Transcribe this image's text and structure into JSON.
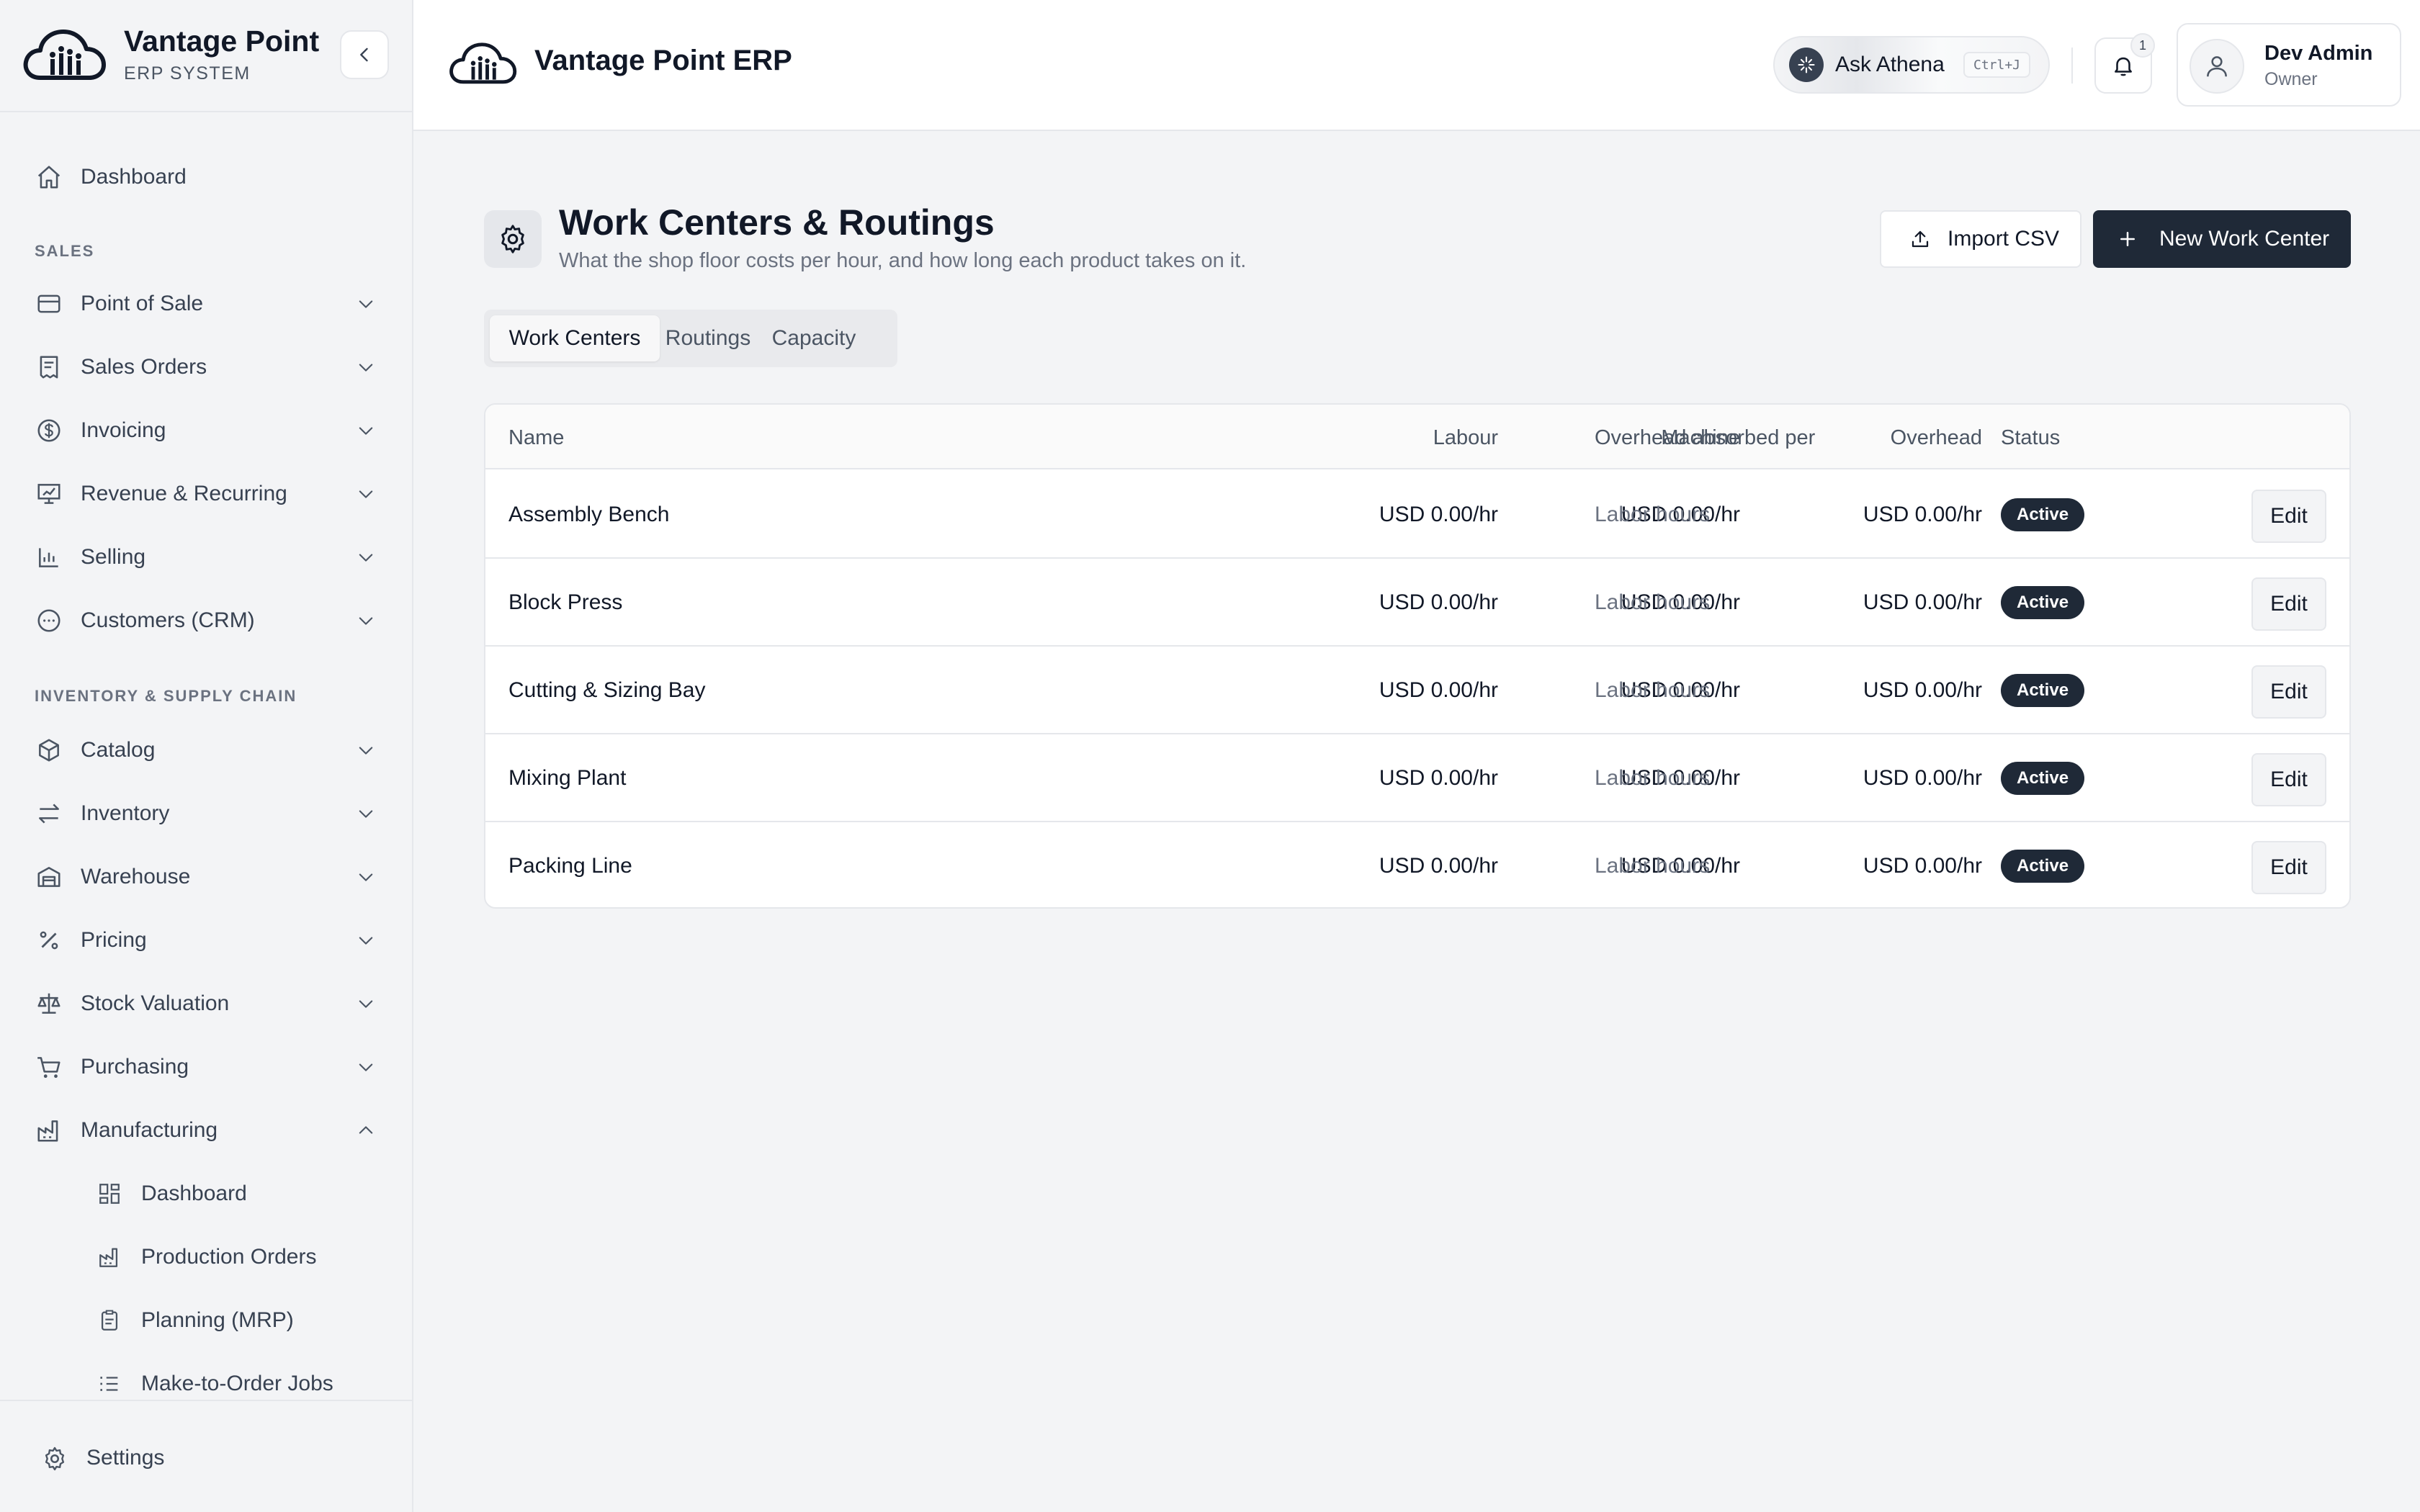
{
  "brand": {
    "title": "Vantage Point",
    "subtitle": "ERP SYSTEM"
  },
  "sidebar": {
    "top_item": {
      "label": "Dashboard",
      "icon": "home-icon"
    },
    "sections": [
      {
        "label": "SALES",
        "items": [
          {
            "label": "Point of Sale",
            "icon": "credit-card-icon",
            "expanded": false
          },
          {
            "label": "Sales Orders",
            "icon": "receipt-icon",
            "expanded": false
          },
          {
            "label": "Invoicing",
            "icon": "dollar-circle-icon",
            "expanded": false
          },
          {
            "label": "Revenue & Recurring",
            "icon": "presentation-chart-icon",
            "expanded": false
          },
          {
            "label": "Selling",
            "icon": "bar-chart-icon",
            "expanded": false
          },
          {
            "label": "Customers (CRM)",
            "icon": "chat-bubble-icon",
            "expanded": false
          }
        ]
      },
      {
        "label": "INVENTORY & SUPPLY CHAIN",
        "items": [
          {
            "label": "Catalog",
            "icon": "package-icon",
            "expanded": false
          },
          {
            "label": "Inventory",
            "icon": "arrows-left-right-icon",
            "expanded": false
          },
          {
            "label": "Warehouse",
            "icon": "warehouse-icon",
            "expanded": false
          },
          {
            "label": "Pricing",
            "icon": "percent-icon",
            "expanded": false
          },
          {
            "label": "Stock Valuation",
            "icon": "scale-icon",
            "expanded": false
          },
          {
            "label": "Purchasing",
            "icon": "shopping-cart-icon",
            "expanded": false
          },
          {
            "label": "Manufacturing",
            "icon": "factory-icon",
            "expanded": true
          }
        ]
      }
    ],
    "manufacturing_children": [
      {
        "label": "Dashboard",
        "icon": "grid-icon"
      },
      {
        "label": "Production Orders",
        "icon": "factory-icon"
      },
      {
        "label": "Planning (MRP)",
        "icon": "clipboard-icon"
      },
      {
        "label": "Make-to-Order Jobs",
        "icon": "list-icon"
      }
    ],
    "footer": {
      "label": "Settings",
      "icon": "gear-icon"
    }
  },
  "topbar": {
    "title": "Vantage Point ERP",
    "ask": {
      "label": "Ask Athena",
      "shortcut": "Ctrl+J"
    },
    "notifications_count": "1",
    "user": {
      "name": "Dev Admin",
      "role": "Owner"
    }
  },
  "page": {
    "title": "Work Centers & Routings",
    "subtitle": "What the shop floor costs per hour, and how long each product takes on it.",
    "import_label": "Import CSV",
    "new_label": "New Work Center"
  },
  "tabs": [
    {
      "label": "Work Centers",
      "active": true
    },
    {
      "label": "Routings",
      "active": false
    },
    {
      "label": "Capacity",
      "active": false
    }
  ],
  "table": {
    "columns": {
      "name": "Name",
      "labour": "Labour",
      "machine": "Machine",
      "overhead": "Overhead",
      "absorbed": "Overhead absorbed per",
      "status": "Status"
    },
    "edit_label": "Edit",
    "rows": [
      {
        "name": "Assembly Bench",
        "labour": "USD 0.00/hr",
        "machine": "USD 0.00/hr",
        "overhead": "USD 0.00/hr",
        "absorbed": "Labor hours",
        "status": "Active"
      },
      {
        "name": "Block Press",
        "labour": "USD 0.00/hr",
        "machine": "USD 0.00/hr",
        "overhead": "USD 0.00/hr",
        "absorbed": "Labor hours",
        "status": "Active"
      },
      {
        "name": "Cutting & Sizing Bay",
        "labour": "USD 0.00/hr",
        "machine": "USD 0.00/hr",
        "overhead": "USD 0.00/hr",
        "absorbed": "Labor hours",
        "status": "Active"
      },
      {
        "name": "Mixing Plant",
        "labour": "USD 0.00/hr",
        "machine": "USD 0.00/hr",
        "overhead": "USD 0.00/hr",
        "absorbed": "Labor hours",
        "status": "Active"
      },
      {
        "name": "Packing Line",
        "labour": "USD 0.00/hr",
        "machine": "USD 0.00/hr",
        "overhead": "USD 0.00/hr",
        "absorbed": "Labor hours",
        "status": "Active"
      }
    ]
  },
  "colors": {
    "accent": "#1f2937",
    "muted": "#6b7280",
    "border": "#e5e7eb",
    "background": "#f3f4f6"
  }
}
